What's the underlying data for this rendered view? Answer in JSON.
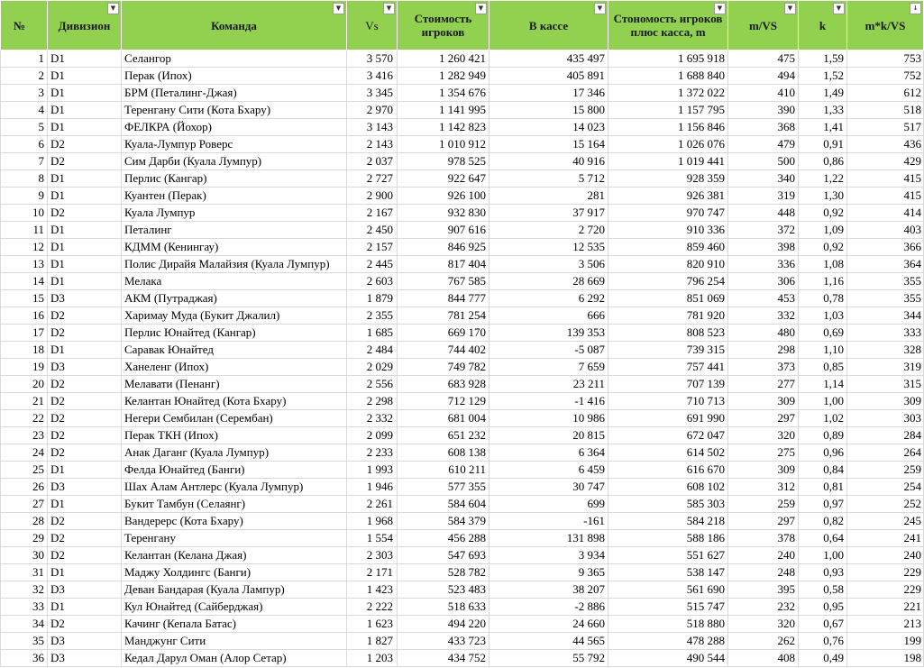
{
  "headers": {
    "num": "№",
    "div": "Дивизион",
    "team": "Команда",
    "vs": "Vs",
    "cost": "Стоимость игроков",
    "cash": "В кассе",
    "total": "Стономость игроков плюс касса, m",
    "mvs": "m/VS",
    "k": "k",
    "mkvs": "m*k/VS"
  },
  "filter_icons": {
    "filter": "▼",
    "sorted": "↓"
  },
  "colors": {
    "header_bg": "#92d050",
    "grid": "#d9d9d9"
  },
  "rows": [
    [
      "1",
      "D1",
      "Селангор",
      "3 570",
      "1 260 421",
      "435 497",
      "1 695 918",
      "475",
      "1,59",
      "753"
    ],
    [
      "2",
      "D1",
      "Перак (Ипох)",
      "3 416",
      "1 282 949",
      "405 891",
      "1 688 840",
      "494",
      "1,52",
      "752"
    ],
    [
      "3",
      "D1",
      "БРМ (Петалинг-Джая)",
      "3 345",
      "1 354 676",
      "17 346",
      "1 372 022",
      "410",
      "1,49",
      "612"
    ],
    [
      "4",
      "D1",
      "Теренгану Сити (Кота Бхару)",
      "2 970",
      "1 141 995",
      "15 800",
      "1 157 795",
      "390",
      "1,33",
      "518"
    ],
    [
      "5",
      "D1",
      "ФЕЛКРА (Йохор)",
      "3 143",
      "1 142 823",
      "14 023",
      "1 156 846",
      "368",
      "1,41",
      "517"
    ],
    [
      "6",
      "D2",
      "Куала-Лумпур Роверс",
      "2 143",
      "1 010 912",
      "15 164",
      "1 026 076",
      "479",
      "0,91",
      "436"
    ],
    [
      "7",
      "D2",
      "Сим Дарби (Куала Лумпур)",
      "2 037",
      "978 525",
      "40 916",
      "1 019 441",
      "500",
      "0,86",
      "429"
    ],
    [
      "8",
      "D1",
      "Перлис (Кангар)",
      "2 727",
      "922 647",
      "5 712",
      "928 359",
      "340",
      "1,22",
      "415"
    ],
    [
      "9",
      "D1",
      "Куантен (Перак)",
      "2 900",
      "926 100",
      "281",
      "926 381",
      "319",
      "1,30",
      "415"
    ],
    [
      "10",
      "D2",
      "Куала Лумпур",
      "2 167",
      "932 830",
      "37 917",
      "970 747",
      "448",
      "0,92",
      "414"
    ],
    [
      "11",
      "D1",
      "Петалинг",
      "2 450",
      "907 616",
      "2 720",
      "910 336",
      "372",
      "1,09",
      "403"
    ],
    [
      "12",
      "D1",
      "КДММ (Кенингау)",
      "2 157",
      "846 925",
      "12 535",
      "859 460",
      "398",
      "0,92",
      "366"
    ],
    [
      "13",
      "D1",
      "Полис Дирайя Малайзия (Куала Лумпур)",
      "2 445",
      "817 404",
      "3 506",
      "820 910",
      "336",
      "1,08",
      "364"
    ],
    [
      "14",
      "D1",
      "Мелака",
      "2 603",
      "767 585",
      "28 669",
      "796 254",
      "306",
      "1,16",
      "355"
    ],
    [
      "15",
      "D3",
      "АКМ (Путраджая)",
      "1 879",
      "844 777",
      "6 292",
      "851 069",
      "453",
      "0,78",
      "355"
    ],
    [
      "16",
      "D2",
      "Харимау Муда (Букит Джалил)",
      "2 355",
      "781 254",
      "666",
      "781 920",
      "332",
      "1,03",
      "344"
    ],
    [
      "17",
      "D2",
      "Перлис Юнайтед (Кангар)",
      "1 685",
      "669 170",
      "139 353",
      "808 523",
      "480",
      "0,69",
      "333"
    ],
    [
      "18",
      "D1",
      "Саравак Юнайтед",
      "2 484",
      "744 402",
      "-5 087",
      "739 315",
      "298",
      "1,10",
      "328"
    ],
    [
      "19",
      "D3",
      "Ханеленг (Ипох)",
      "2 029",
      "749 782",
      "7 659",
      "757 441",
      "373",
      "0,85",
      "319"
    ],
    [
      "20",
      "D2",
      "Мелавати (Пенанг)",
      "2 556",
      "683 928",
      "23 211",
      "707 139",
      "277",
      "1,14",
      "315"
    ],
    [
      "21",
      "D2",
      "Келантан Юнайтед (Кота Бхару)",
      "2 298",
      "712 129",
      "-1 416",
      "710 713",
      "309",
      "1,00",
      "309"
    ],
    [
      "22",
      "D2",
      "Негери Сембилан (Серембан)",
      "2 332",
      "681 004",
      "10 986",
      "691 990",
      "297",
      "1,02",
      "303"
    ],
    [
      "23",
      "D2",
      "Перак ТКН (Ипох)",
      "2 099",
      "651 232",
      "20 815",
      "672 047",
      "320",
      "0,89",
      "284"
    ],
    [
      "24",
      "D2",
      "Анак Даганг (Куала Лумпур)",
      "2 233",
      "608 138",
      "6 364",
      "614 502",
      "275",
      "0,96",
      "264"
    ],
    [
      "25",
      "D1",
      "Фелда Юнайтед (Банги)",
      "1 993",
      "610 211",
      "6 459",
      "616 670",
      "309",
      "0,84",
      "259"
    ],
    [
      "26",
      "D3",
      "Шах Алам Антлерс (Куала Лумпур)",
      "1 946",
      "577 355",
      "30 747",
      "608 102",
      "312",
      "0,81",
      "254"
    ],
    [
      "27",
      "D1",
      "Букит Тамбун (Селаянг)",
      "2 261",
      "584 604",
      "699",
      "585 303",
      "259",
      "0,97",
      "252"
    ],
    [
      "28",
      "D2",
      "Вандерерс (Кота Бхару)",
      "1 968",
      "584 379",
      "-161",
      "584 218",
      "297",
      "0,82",
      "245"
    ],
    [
      "29",
      "D2",
      "Теренгану",
      "1 554",
      "456 288",
      "131 898",
      "588 186",
      "378",
      "0,64",
      "241"
    ],
    [
      "30",
      "D2",
      "Келантан (Келана Джая)",
      "2 303",
      "547 693",
      "3 934",
      "551 627",
      "240",
      "1,00",
      "240"
    ],
    [
      "31",
      "D1",
      "Маджу Холдингс (Банги)",
      "2 171",
      "528 782",
      "9 365",
      "538 147",
      "248",
      "0,93",
      "229"
    ],
    [
      "32",
      "D3",
      "Деван Бандарая (Куала Лампур)",
      "1 423",
      "523 483",
      "38 207",
      "561 690",
      "395",
      "0,58",
      "229"
    ],
    [
      "33",
      "D1",
      "Кул Юнайтед (Сайберджая)",
      "2 222",
      "518 633",
      "-2 886",
      "515 747",
      "232",
      "0,95",
      "221"
    ],
    [
      "34",
      "D2",
      "Качинг (Кепала Батас)",
      "1 623",
      "494 220",
      "24 660",
      "518 880",
      "320",
      "0,67",
      "213"
    ],
    [
      "35",
      "D3",
      "Манджунг Сити",
      "1 827",
      "433 723",
      "44 565",
      "478 288",
      "262",
      "0,76",
      "199"
    ],
    [
      "36",
      "D3",
      "Кедал Дарул Оман (Алор Сетар)",
      "1 203",
      "434 752",
      "55 792",
      "490 544",
      "408",
      "0,49",
      "198"
    ]
  ]
}
